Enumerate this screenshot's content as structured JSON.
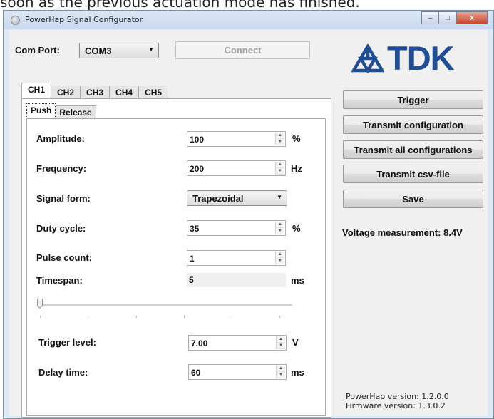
{
  "doc_text": "soon as the previous actuation mode has finished.",
  "window": {
    "title": "PowerHap Signal Configurator",
    "caption": {
      "minimize": "–",
      "maximize": "□",
      "close": "x"
    }
  },
  "com_port": {
    "label": "Com Port:",
    "value": "COM3",
    "connect_label": "Connect"
  },
  "logo": {
    "text": "TDK",
    "color": "#1f4e96"
  },
  "channel_tabs": [
    "CH1",
    "CH2",
    "CH3",
    "CH4",
    "CH5"
  ],
  "active_channel": "CH1",
  "sub_tabs": [
    "Push",
    "Release"
  ],
  "active_sub_tab": "Push",
  "form": {
    "amplitude": {
      "label": "Amplitude:",
      "value": "100",
      "unit": "%"
    },
    "frequency": {
      "label": "Frequency:",
      "value": "200",
      "unit": "Hz"
    },
    "signal_form": {
      "label": "Signal form:",
      "value": "Trapezoidal"
    },
    "duty_cycle": {
      "label": "Duty cycle:",
      "value": "35",
      "unit": "%"
    },
    "pulse_count": {
      "label": "Pulse count:",
      "value": "1"
    },
    "timespan": {
      "label": "Timespan:",
      "value": "5",
      "unit": "ms"
    },
    "slider_level": 0,
    "trigger_level": {
      "label": "Trigger level:",
      "value": "7.00",
      "unit": "V"
    },
    "delay_time": {
      "label": "Delay time:",
      "value": "60",
      "unit": "ms"
    }
  },
  "buttons": {
    "trigger": "Trigger",
    "transmit_configuration": "Transmit configuration",
    "transmit_all": "Transmit all configurations",
    "transmit_csv": "Transmit csv-file",
    "save": "Save"
  },
  "voltage_measurement": "Voltage measurement: 8.4V",
  "versions": {
    "powerhap": "PowerHap version:  1.2.0.0",
    "firmware": "Firmware version:  1.3.0.2"
  }
}
